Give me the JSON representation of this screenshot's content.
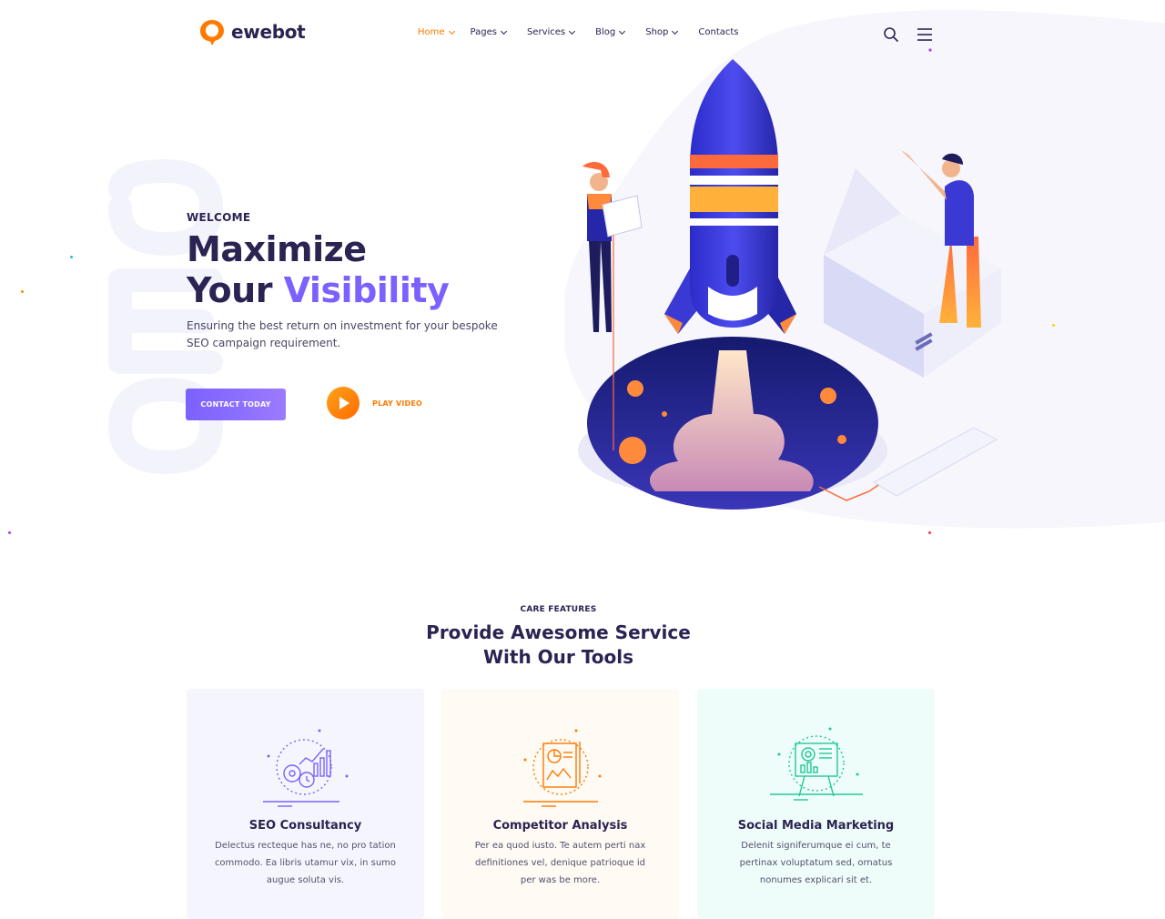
{
  "brand": {
    "name": "ewebot",
    "accent": "#ff7a00",
    "primary": "#7b61ff",
    "text": "#2b2352"
  },
  "nav": {
    "items": [
      {
        "label": "Home",
        "dropdown": true,
        "active": true
      },
      {
        "label": "Pages",
        "dropdown": true
      },
      {
        "label": "Services",
        "dropdown": true
      },
      {
        "label": "Blog",
        "dropdown": true
      },
      {
        "label": "Shop",
        "dropdown": true
      },
      {
        "label": "Contacts",
        "dropdown": false
      }
    ],
    "search_icon": "search-icon",
    "menu_icon": "hamburger-menu-icon"
  },
  "hero": {
    "kicker": "WELCOME",
    "title_line1": "Maximize",
    "title_line2_a": "Your ",
    "title_line2_b": "Visibility",
    "description": "Ensuring the best return on investment for your bespoke SEO campaign requirement.",
    "cta_label": "CONTACT TODAY",
    "video_label": "PLAY VIDEO",
    "bg_word": "SEO"
  },
  "features": {
    "kicker": "CARE FEATURES",
    "title_line1": "Provide Awesome Service",
    "title_line2": "With Our Tools",
    "cards": [
      {
        "title": "SEO Consultancy",
        "description": "Delectus recteque has ne, no pro tation commodo. Ea libris utamur vix, in sumo augue soluta vis.",
        "bg": "#f5f6fd",
        "icon_color": "#7b61ff",
        "icon": "seo-chart-gears-icon"
      },
      {
        "title": "Competitor Analysis",
        "description": "Per ea quod iusto. Te autem perti nax definitiones vel, denique patrioque id per was be more.",
        "bg": "#fffaf3",
        "icon_color": "#ff7a00",
        "icon": "report-analysis-icon"
      },
      {
        "title": "Social Media Marketing",
        "description": "Delenit signiferumque ei cum, te pertinax voluptatum sed, ornatus nonumes explicari sit et.",
        "bg": "#eefdf9",
        "icon_color": "#20c997",
        "icon": "presentation-board-icon"
      }
    ]
  }
}
